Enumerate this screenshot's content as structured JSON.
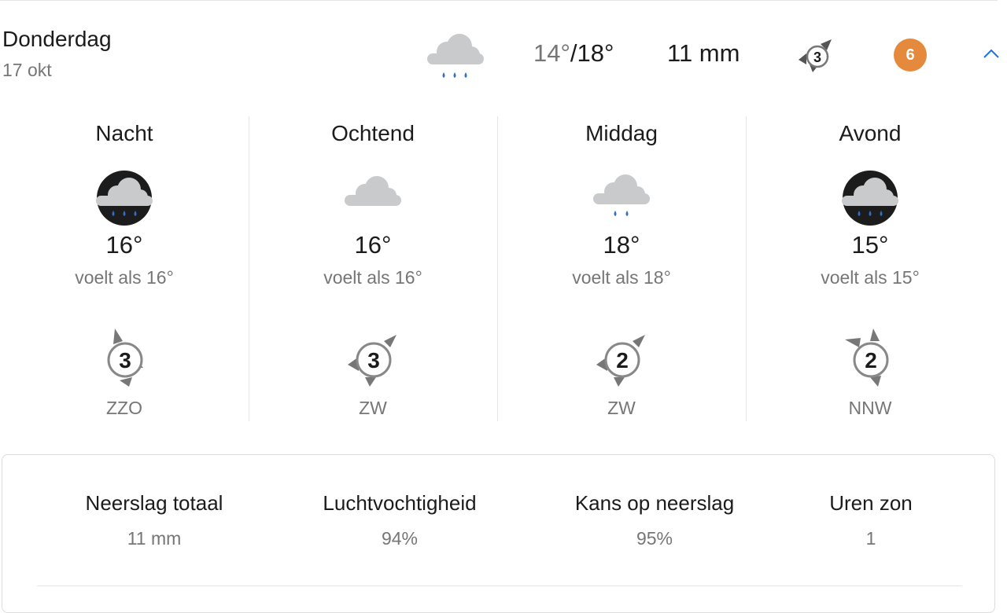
{
  "day": {
    "name": "Donderdag",
    "date": "17 okt",
    "icon": "cloud-rain-icon",
    "temp_min": "14°",
    "temp_sep": "/",
    "temp_max": "18°",
    "precipitation": "11 mm",
    "wind_force": "3",
    "uv_index": "6"
  },
  "parts": [
    {
      "title": "Nacht",
      "icon": "night-cloud-rain-icon",
      "temp": "16°",
      "feels_like": "voelt als 16°",
      "wind_force": "3",
      "wind_dir": "ZZO"
    },
    {
      "title": "Ochtend",
      "icon": "cloud-icon",
      "temp": "16°",
      "feels_like": "voelt als 16°",
      "wind_force": "3",
      "wind_dir": "ZW"
    },
    {
      "title": "Middag",
      "icon": "cloud-light-rain-icon",
      "temp": "18°",
      "feels_like": "voelt als 18°",
      "wind_force": "2",
      "wind_dir": "ZW"
    },
    {
      "title": "Avond",
      "icon": "night-cloud-rain-icon",
      "temp": "15°",
      "feels_like": "voelt als 15°",
      "wind_force": "2",
      "wind_dir": "NNW"
    }
  ],
  "summary": {
    "precip_total_label": "Neerslag totaal",
    "precip_total_value": "11 mm",
    "humidity_label": "Luchtvochtigheid",
    "humidity_value": "94%",
    "precip_chance_label": "Kans op neerslag",
    "precip_chance_value": "95%",
    "sun_hours_label": "Uren zon",
    "sun_hours_value": "1"
  },
  "colors": {
    "uv_badge": "#e58a3c",
    "rain_drop": "#2f6fc6",
    "cloud": "#c9cacc",
    "night_disc": "#1c1c1c",
    "accent": "#1a73e8"
  }
}
